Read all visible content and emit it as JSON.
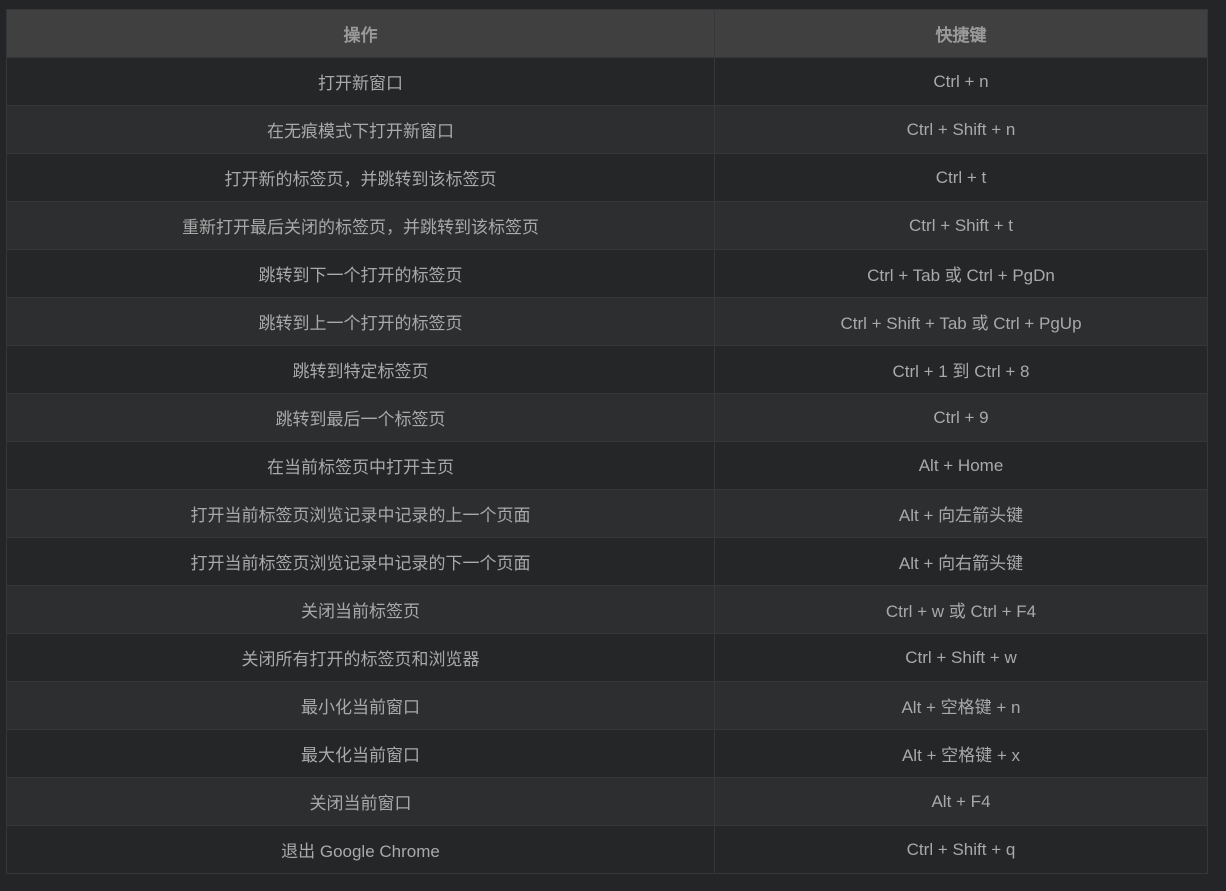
{
  "colors": {
    "background": "#242527",
    "header": "#404040",
    "row_odd": "#252628",
    "row_even": "#2d2e30",
    "text": "#a9a9a9"
  },
  "table": {
    "headers": [
      "操作",
      "快捷键"
    ],
    "rows": [
      [
        "打开新窗口",
        "Ctrl + n"
      ],
      [
        "在无痕模式下打开新窗口",
        "Ctrl + Shift + n"
      ],
      [
        "打开新的标签页，并跳转到该标签页",
        "Ctrl + t"
      ],
      [
        "重新打开最后关闭的标签页，并跳转到该标签页",
        "Ctrl + Shift + t"
      ],
      [
        "跳转到下一个打开的标签页",
        "Ctrl + Tab 或 Ctrl + PgDn"
      ],
      [
        "跳转到上一个打开的标签页",
        "Ctrl + Shift + Tab 或 Ctrl + PgUp"
      ],
      [
        "跳转到特定标签页",
        "Ctrl + 1 到 Ctrl + 8"
      ],
      [
        "跳转到最后一个标签页",
        "Ctrl + 9"
      ],
      [
        "在当前标签页中打开主页",
        "Alt + Home"
      ],
      [
        "打开当前标签页浏览记录中记录的上一个页面",
        "Alt + 向左箭头键"
      ],
      [
        "打开当前标签页浏览记录中记录的下一个页面",
        "Alt + 向右箭头键"
      ],
      [
        "关闭当前标签页",
        "Ctrl + w 或 Ctrl + F4"
      ],
      [
        "关闭所有打开的标签页和浏览器",
        "Ctrl + Shift + w"
      ],
      [
        "最小化当前窗口",
        "Alt + 空格键 + n"
      ],
      [
        "最大化当前窗口",
        "Alt + 空格键 + x"
      ],
      [
        "关闭当前窗口",
        "Alt + F4"
      ],
      [
        "退出 Google Chrome",
        "Ctrl + Shift + q"
      ]
    ]
  }
}
